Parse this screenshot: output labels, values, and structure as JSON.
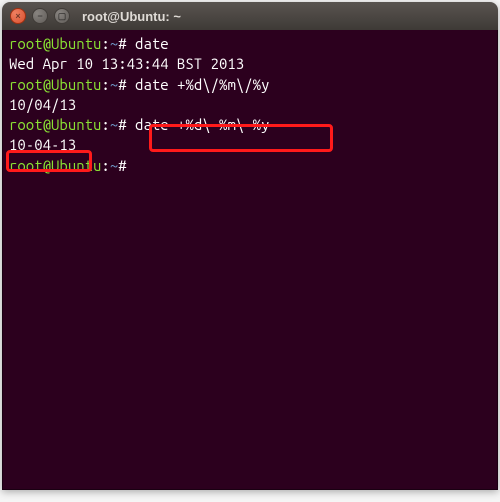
{
  "titlebar": {
    "title": "root@Ubuntu: ~"
  },
  "lines": {
    "l1": {
      "user": "root",
      "host": "Ubuntu",
      "path": "~",
      "sigil": "#",
      "cmd": "date"
    },
    "l2": {
      "out": "Wed Apr 10 13:43:44 BST 2013"
    },
    "l3": {
      "user": "root",
      "host": "Ubuntu",
      "path": "~",
      "sigil": "#",
      "cmd": "date +%d\\/%m\\/%y"
    },
    "l4": {
      "out": "10/04/13"
    },
    "l5": {
      "user": "root",
      "host": "Ubuntu",
      "path": "~",
      "sigil": "#",
      "cmd": "date +%d\\-%m\\-%y"
    },
    "l6": {
      "out": "10-04-13"
    },
    "l7": {
      "user": "root",
      "host": "Ubuntu",
      "path": "~",
      "sigil": "#",
      "cmd": ""
    }
  },
  "annotations": {
    "hl1_target": "date +%d\\-%m\\-%y",
    "hl2_target": "10-04-13"
  },
  "icons": {
    "close": "×",
    "minimize": "−",
    "maximize": "▢"
  }
}
